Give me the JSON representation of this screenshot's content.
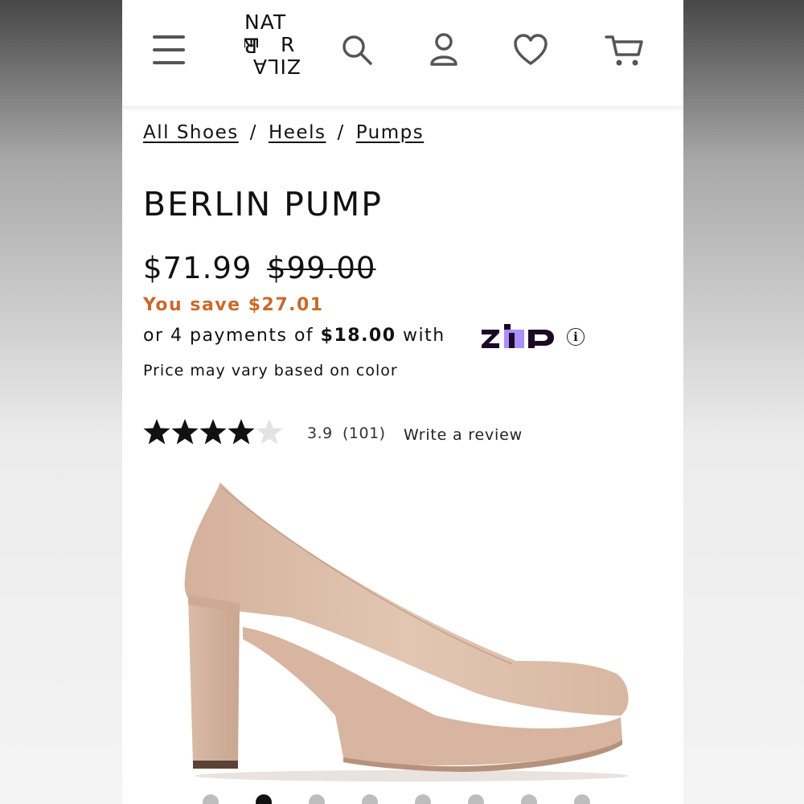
{
  "header": {
    "menu_icon": "hamburger-menu-icon",
    "logo_text": "NATURALIZER",
    "logo_rows": [
      "NAT",
      "ER UR",
      "ZILA"
    ],
    "search_icon": "search-icon",
    "account_icon": "account-icon",
    "wishlist_icon": "heart-icon",
    "cart_icon": "cart-icon"
  },
  "breadcrumb": [
    "All Shoes",
    "Heels",
    "Pumps"
  ],
  "breadcrumb_separator": "/",
  "product": {
    "name": "BERLIN PUMP",
    "price": "$71.99",
    "original_price": "$99.00",
    "savings": "You save $27.01",
    "installment_prefix": "or 4 payments of ",
    "installment_amount": "$18.00",
    "installment_suffix": " with",
    "installment_provider": "zip",
    "price_note": "Price may vary based on color"
  },
  "reviews": {
    "rating": "3.9",
    "rating_value": 3.9,
    "rating_max": 5,
    "count": "(101)",
    "write_review": "Write a review"
  },
  "gallery": {
    "image": "product-shoe-image",
    "slide_count": 8,
    "active_index": 1
  },
  "colors": {
    "accent_orange": "#c86a2a",
    "zip_purple": "#aa8fff",
    "zip_dark": "#1a0826",
    "shoe_color": "#d9b9a3"
  }
}
